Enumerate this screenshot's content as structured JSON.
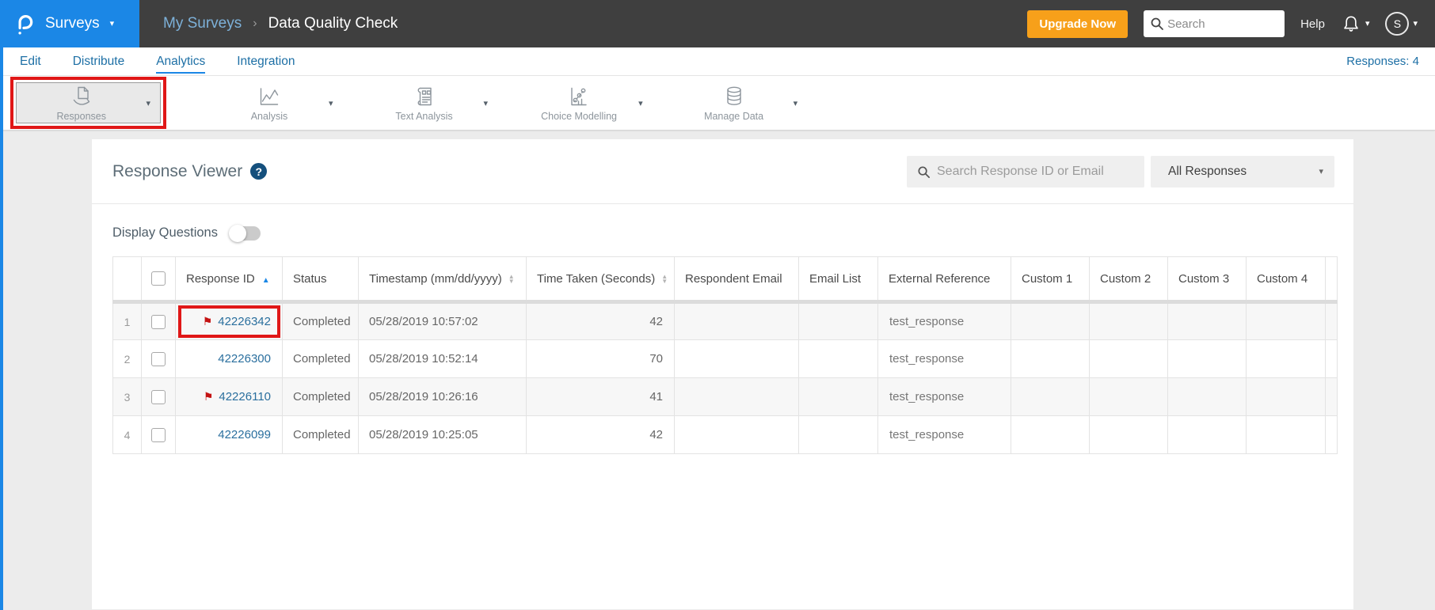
{
  "topbar": {
    "product": "Surveys",
    "breadcrumb": {
      "parent": "My Surveys",
      "separator": "›",
      "current": "Data Quality Check"
    },
    "upgrade_label": "Upgrade Now",
    "search_placeholder": "Search",
    "help_label": "Help",
    "avatar_initial": "S"
  },
  "nav": {
    "items": [
      {
        "label": "Edit",
        "active": false
      },
      {
        "label": "Distribute",
        "active": false
      },
      {
        "label": "Analytics",
        "active": true
      },
      {
        "label": "Integration",
        "active": false
      }
    ],
    "responses_count": "Responses: 4"
  },
  "toolbar": {
    "responses": "Responses",
    "analysis": "Analysis",
    "text_analysis": "Text Analysis",
    "choice_modelling": "Choice Modelling",
    "manage_data": "Manage Data"
  },
  "viewer": {
    "title": "Response Viewer",
    "help_glyph": "?",
    "search_placeholder": "Search Response ID or Email",
    "filter_selected": "All Responses",
    "display_questions_label": "Display Questions",
    "display_questions_state": "off"
  },
  "table": {
    "headers": {
      "response_id": "Response ID",
      "status": "Status",
      "timestamp": "Timestamp (mm/dd/yyyy)",
      "time_taken": "Time Taken (Seconds)",
      "respondent_email": "Respondent Email",
      "email_list": "Email List",
      "external_reference": "External Reference",
      "custom1": "Custom 1",
      "custom2": "Custom 2",
      "custom3": "Custom 3",
      "custom4": "Custom 4"
    },
    "sort": {
      "column": "Response ID",
      "direction": "asc"
    },
    "rows": [
      {
        "num": "1",
        "response_id": "42226342",
        "flagged": true,
        "annotated": true,
        "status": "Completed",
        "timestamp": "05/28/2019 10:57:02",
        "time_taken": "42",
        "respondent_email": "",
        "email_list": "",
        "external_reference": "test_response",
        "custom1": "",
        "custom2": "",
        "custom3": "",
        "custom4": ""
      },
      {
        "num": "2",
        "response_id": "42226300",
        "flagged": false,
        "annotated": false,
        "status": "Completed",
        "timestamp": "05/28/2019 10:52:14",
        "time_taken": "70",
        "respondent_email": "",
        "email_list": "",
        "external_reference": "test_response",
        "custom1": "",
        "custom2": "",
        "custom3": "",
        "custom4": ""
      },
      {
        "num": "3",
        "response_id": "42226110",
        "flagged": true,
        "annotated": false,
        "status": "Completed",
        "timestamp": "05/28/2019 10:26:16",
        "time_taken": "41",
        "respondent_email": "",
        "email_list": "",
        "external_reference": "test_response",
        "custom1": "",
        "custom2": "",
        "custom3": "",
        "custom4": ""
      },
      {
        "num": "4",
        "response_id": "42226099",
        "flagged": false,
        "annotated": false,
        "status": "Completed",
        "timestamp": "05/28/2019 10:25:05",
        "time_taken": "42",
        "respondent_email": "",
        "email_list": "",
        "external_reference": "test_response",
        "custom1": "",
        "custom2": "",
        "custom3": "",
        "custom4": ""
      }
    ]
  },
  "colors": {
    "brand_blue": "#1b87e6",
    "topbar_dark": "#3f3f3f",
    "upgrade_orange": "#f7a01a",
    "link_blue": "#1d6fa5",
    "table_link_blue": "#2a6f9e",
    "annotation_red": "#e01717",
    "flag_red": "#c41212"
  }
}
